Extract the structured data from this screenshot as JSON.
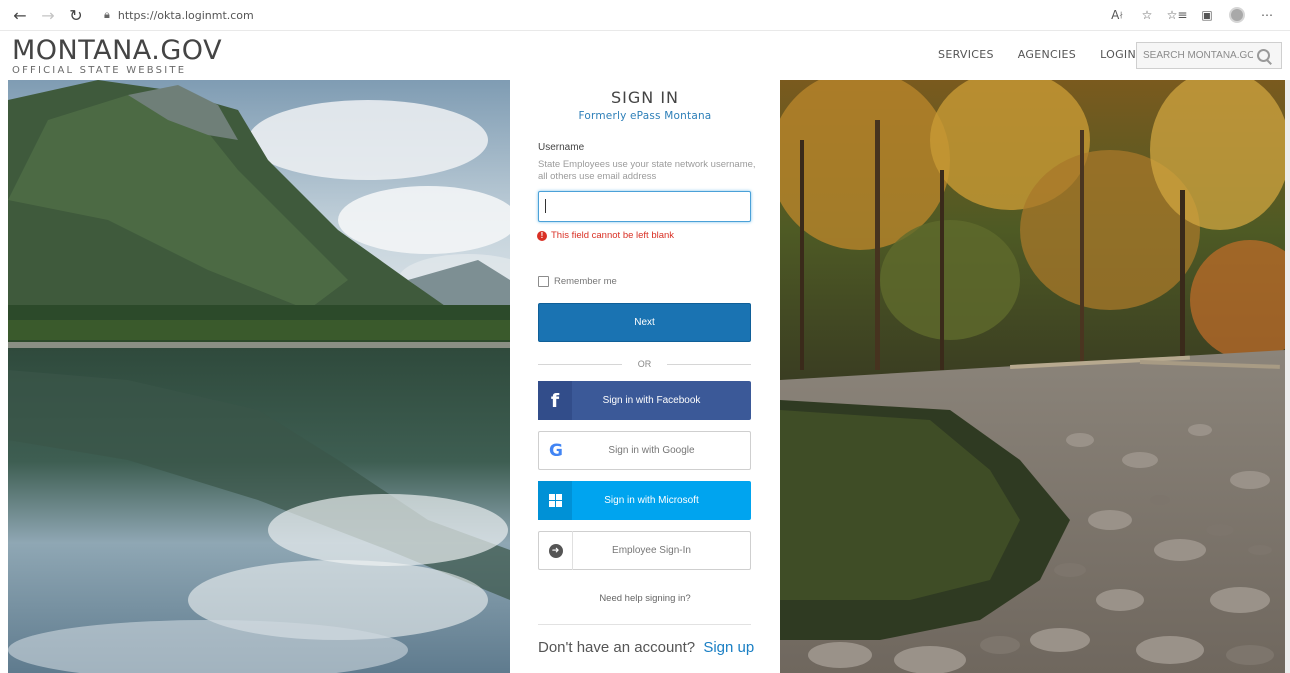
{
  "browser": {
    "url": "https://okta.loginmt.com",
    "icons": [
      "back-arrow-icon",
      "forward-arrow-icon",
      "refresh-icon",
      "lock-icon",
      "read-aloud-icon",
      "favorite-star-icon",
      "favorites-list-icon",
      "collections-icon",
      "profile-avatar",
      "more-icon"
    ]
  },
  "header": {
    "brand_title": "MONTANA.GOV",
    "brand_subtitle": "OFFICIAL STATE WEBSITE",
    "nav": {
      "services": "SERVICES",
      "agencies": "AGENCIES",
      "login": "LOGIN"
    },
    "search_placeholder": "SEARCH MONTANA.GOV"
  },
  "login": {
    "title": "SIGN IN",
    "subtitle": "Formerly ePass Montana",
    "username_label": "Username",
    "username_hint": "State Employees use your state network username, all others use email address",
    "username_value": "",
    "error_icon": "!",
    "error_text": "This field cannot be left blank",
    "remember_label": "Remember me",
    "remember_checked": false,
    "next_label": "Next",
    "divider_text": "OR",
    "facebook_icon": "f",
    "facebook_label": "Sign in with Facebook",
    "google_icon": "G",
    "google_label": "Sign in with Google",
    "microsoft_label": "Sign in with Microsoft",
    "employee_label": "Employee Sign-In",
    "help_text": "Need help signing in?",
    "no_account_text": "Don't have an account?",
    "signup_label": "Sign up"
  },
  "colors": {
    "primary_blue": "#1a73b2",
    "subtitle_blue": "#2d7fb8",
    "facebook": "#3b5998",
    "microsoft": "#00a4ef",
    "error_red": "#d93025",
    "signup_link": "#1a7fc4"
  }
}
